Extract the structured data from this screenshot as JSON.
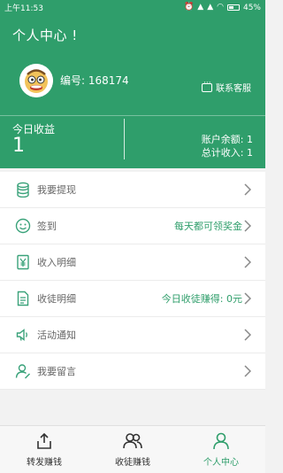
{
  "status_bar": {
    "time": "上午11:53",
    "battery": "45%",
    "icons": [
      "alarm-icon",
      "signal-icon",
      "signal-icon",
      "wifi-icon",
      "battery-icon"
    ]
  },
  "header": {
    "title": "个人中心 !",
    "user_id": "编号: 168174",
    "support_label": "联系客服",
    "today_earnings_label": "今日收益",
    "today_earnings_value": "1",
    "balance": "账户余额: 1",
    "total_income": "总计收入: 1"
  },
  "menu": {
    "items": [
      {
        "label": "我要提现",
        "extra": "",
        "icon": "coins-icon"
      },
      {
        "label": "签到",
        "extra": "每天都可领奖金",
        "icon": "smiley-icon"
      },
      {
        "label": "收入明细",
        "extra": "",
        "icon": "yen-card-icon"
      },
      {
        "label": "收徒明细",
        "extra": "今日收徒赚得: 0元",
        "icon": "document-icon"
      },
      {
        "label": "活动通知",
        "extra": "",
        "icon": "speaker-icon"
      },
      {
        "label": "我要留言",
        "extra": "",
        "icon": "user-edit-icon"
      }
    ]
  },
  "tabbar": {
    "tabs": [
      {
        "label": "转发赚钱",
        "icon": "share-icon",
        "active": false
      },
      {
        "label": "收徒赚钱",
        "icon": "people-icon",
        "active": false
      },
      {
        "label": "个人中心",
        "icon": "person-icon",
        "active": true
      }
    ]
  },
  "colors": {
    "primary": "#2f9e6b",
    "icon_teal": "#3aa27a",
    "text_gray": "#666666",
    "background": "#f2f2f2"
  }
}
